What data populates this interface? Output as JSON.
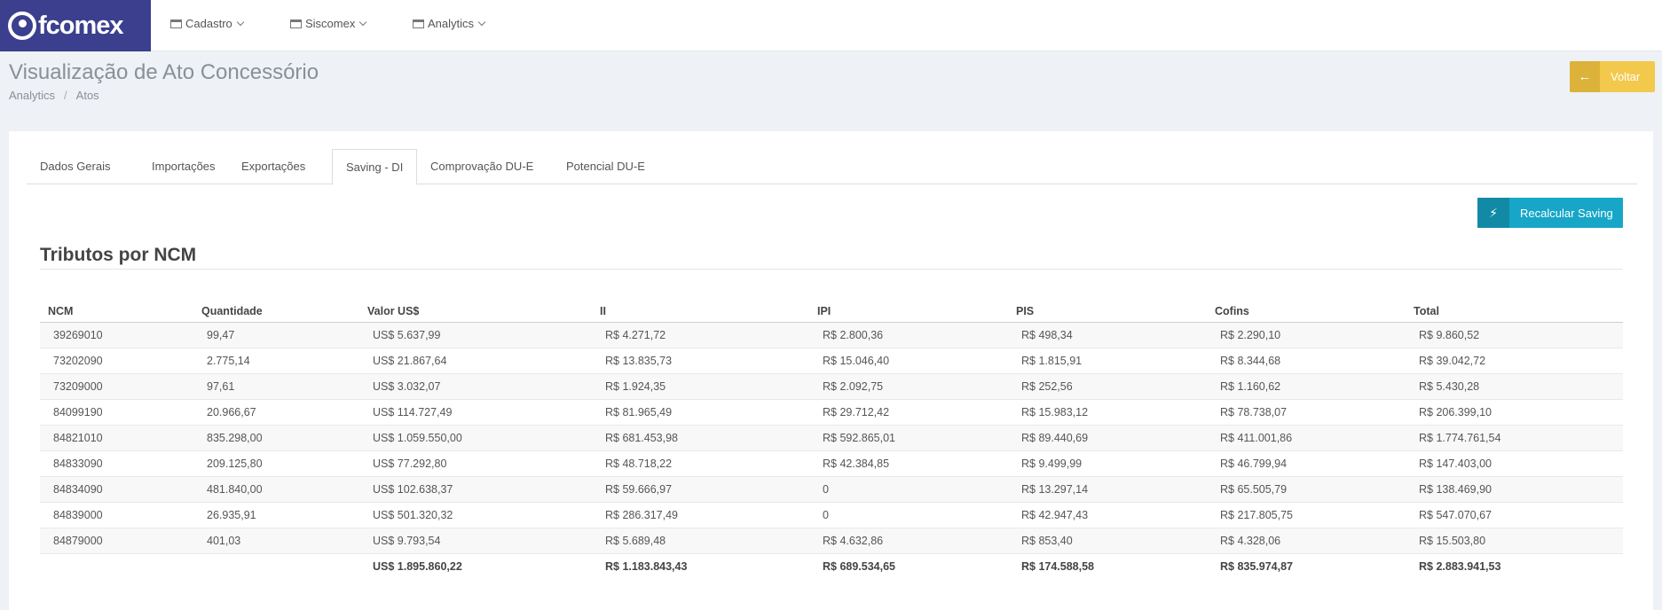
{
  "app": {
    "logo_text": "fcomex"
  },
  "nav": [
    {
      "label": "Cadastro"
    },
    {
      "label": "Siscomex"
    },
    {
      "label": "Analytics"
    }
  ],
  "page": {
    "title": "Visualização de Ato Concessório",
    "breadcrumb": [
      "Analytics",
      "Atos"
    ],
    "back_button": "Voltar"
  },
  "tabs": [
    {
      "label": "Dados Gerais",
      "active": false
    },
    {
      "label": "Importações",
      "active": false
    },
    {
      "label": "Exportações",
      "active": false
    },
    {
      "label": "Saving - DI",
      "active": true
    },
    {
      "label": "Comprovação DU-E",
      "active": false
    },
    {
      "label": "Potencial DU-E",
      "active": false
    }
  ],
  "recalc_button": "Recalcular Saving",
  "section_title": "Tributos por NCM",
  "table": {
    "columns": [
      "NCM",
      "Quantidade",
      "Valor US$",
      "II",
      "IPI",
      "PIS",
      "Cofins",
      "Total"
    ],
    "rows": [
      [
        "39269010",
        "99,47",
        "US$ 5.637,99",
        "R$ 4.271,72",
        "R$ 2.800,36",
        "R$ 498,34",
        "R$ 2.290,10",
        "R$ 9.860,52"
      ],
      [
        "73202090",
        "2.775,14",
        "US$ 21.867,64",
        "R$ 13.835,73",
        "R$ 15.046,40",
        "R$ 1.815,91",
        "R$ 8.344,68",
        "R$ 39.042,72"
      ],
      [
        "73209000",
        "97,61",
        "US$ 3.032,07",
        "R$ 1.924,35",
        "R$ 2.092,75",
        "R$ 252,56",
        "R$ 1.160,62",
        "R$ 5.430,28"
      ],
      [
        "84099190",
        "20.966,67",
        "US$ 114.727,49",
        "R$ 81.965,49",
        "R$ 29.712,42",
        "R$ 15.983,12",
        "R$ 78.738,07",
        "R$ 206.399,10"
      ],
      [
        "84821010",
        "835.298,00",
        "US$ 1.059.550,00",
        "R$ 681.453,98",
        "R$ 592.865,01",
        "R$ 89.440,69",
        "R$ 411.001,86",
        "R$ 1.774.761,54"
      ],
      [
        "84833090",
        "209.125,80",
        "US$ 77.292,80",
        "R$ 48.718,22",
        "R$ 42.384,85",
        "R$ 9.499,99",
        "R$ 46.799,94",
        "R$ 147.403,00"
      ],
      [
        "84834090",
        "481.840,00",
        "US$ 102.638,37",
        "R$ 59.666,97",
        "0",
        "R$ 13.297,14",
        "R$ 65.505,79",
        "R$ 138.469,90"
      ],
      [
        "84839000",
        "26.935,91",
        "US$ 501.320,32",
        "R$ 286.317,49",
        "0",
        "R$ 42.947,43",
        "R$ 217.805,75",
        "R$ 547.070,67"
      ],
      [
        "84879000",
        "401,03",
        "US$ 9.793,54",
        "R$ 5.689,48",
        "R$ 4.632,86",
        "R$ 853,40",
        "R$ 4.328,06",
        "R$ 15.503,80"
      ]
    ],
    "totals": [
      "",
      "",
      "US$ 1.895.860,22",
      "R$ 1.183.843,43",
      "R$ 689.534,65",
      "R$ 174.588,58",
      "R$ 835.974,87",
      "R$ 2.883.941,53"
    ]
  },
  "colors": {
    "brand": "#3b3f8e",
    "warning": "#f2c94c",
    "info": "#17a6c7"
  }
}
